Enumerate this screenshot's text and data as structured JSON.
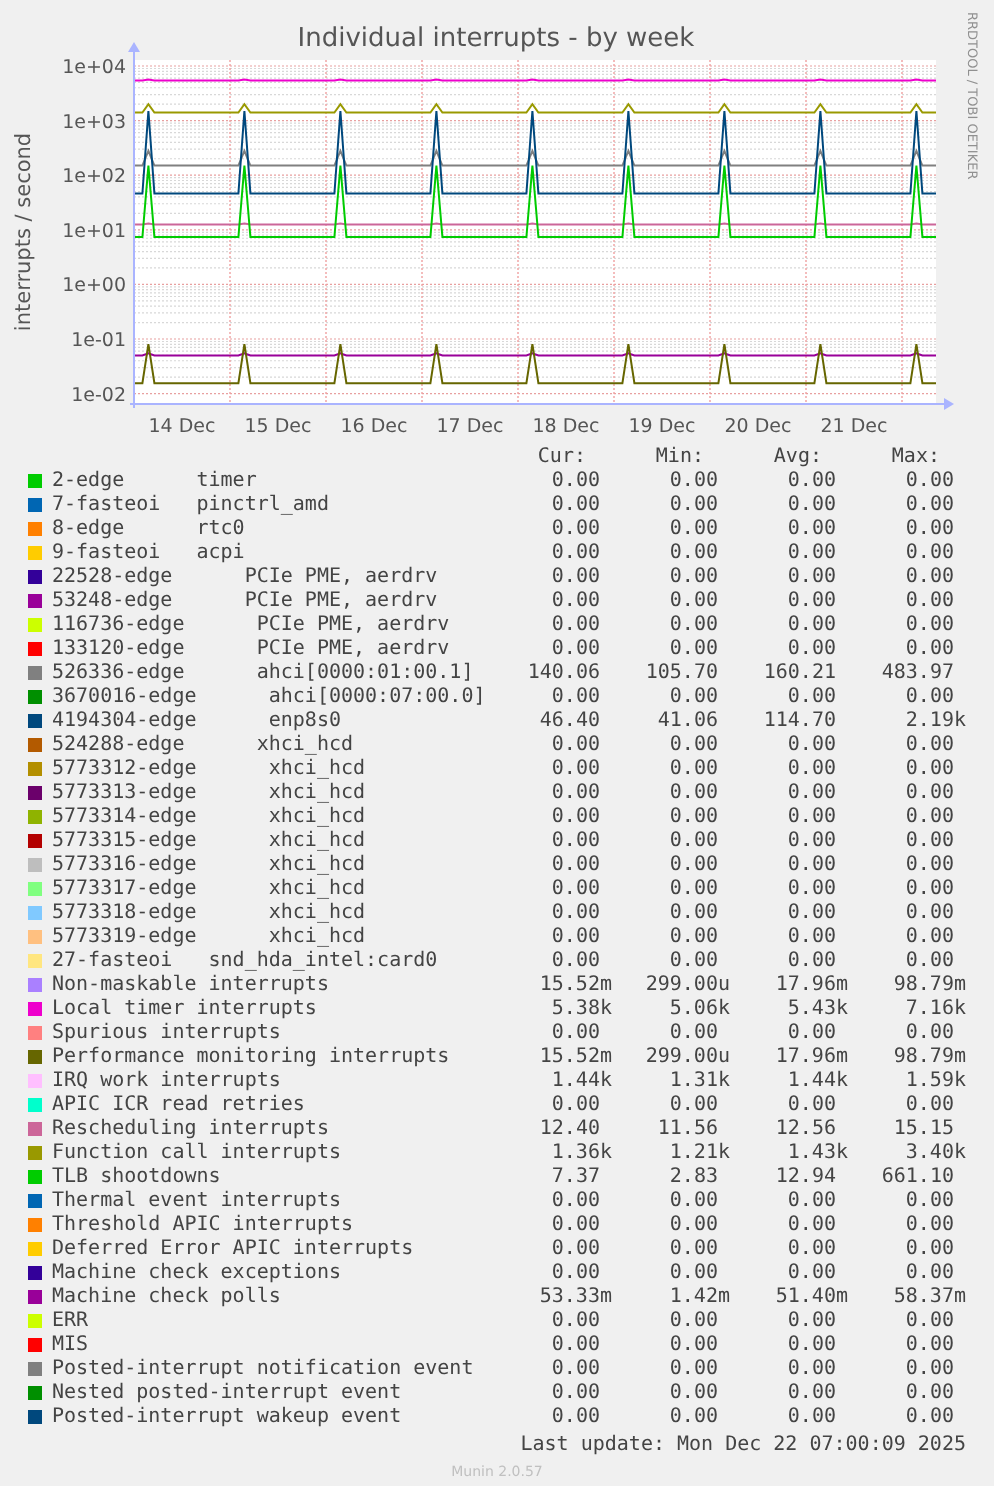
{
  "side_text": "RRDTOOL / TOBI OETIKER",
  "chart": {
    "title": "Individual interrupts - by week",
    "ylabel": "interrupts / second",
    "y_tick_labels": [
      "1e+04",
      "1e+03",
      "1e+02",
      "1e+01",
      "1e+00",
      "1e-01",
      "1e-02"
    ],
    "x_tick_labels": [
      "14 Dec",
      "15 Dec",
      "16 Dec",
      "17 Dec",
      "18 Dec",
      "19 Dec",
      "20 Dec",
      "21 Dec"
    ]
  },
  "legend": {
    "columns": [
      "Cur:",
      "Min:",
      "Avg:",
      "Max:"
    ],
    "rows": [
      {
        "name": "2-edge      timer",
        "color": "#00cc00",
        "cur": "0.00",
        "min": "0.00",
        "avg": "0.00",
        "max": "0.00"
      },
      {
        "name": "7-fasteoi   pinctrl_amd",
        "color": "#0066b3",
        "cur": "0.00",
        "min": "0.00",
        "avg": "0.00",
        "max": "0.00"
      },
      {
        "name": "8-edge      rtc0",
        "color": "#ff8000",
        "cur": "0.00",
        "min": "0.00",
        "avg": "0.00",
        "max": "0.00"
      },
      {
        "name": "9-fasteoi   acpi",
        "color": "#ffcc00",
        "cur": "0.00",
        "min": "0.00",
        "avg": "0.00",
        "max": "0.00"
      },
      {
        "name": "22528-edge      PCIe PME, aerdrv",
        "color": "#330099",
        "cur": "0.00",
        "min": "0.00",
        "avg": "0.00",
        "max": "0.00"
      },
      {
        "name": "53248-edge      PCIe PME, aerdrv",
        "color": "#990099",
        "cur": "0.00",
        "min": "0.00",
        "avg": "0.00",
        "max": "0.00"
      },
      {
        "name": "116736-edge      PCIe PME, aerdrv",
        "color": "#ccff00",
        "cur": "0.00",
        "min": "0.00",
        "avg": "0.00",
        "max": "0.00"
      },
      {
        "name": "133120-edge      PCIe PME, aerdrv",
        "color": "#ff0000",
        "cur": "0.00",
        "min": "0.00",
        "avg": "0.00",
        "max": "0.00"
      },
      {
        "name": "526336-edge      ahci[0000:01:00.1]",
        "color": "#808080",
        "cur": "140.06",
        "min": "105.70",
        "avg": "160.21",
        "max": "483.97"
      },
      {
        "name": "3670016-edge      ahci[0000:07:00.0]",
        "color": "#008f00",
        "cur": "0.00",
        "min": "0.00",
        "avg": "0.00",
        "max": "0.00"
      },
      {
        "name": "4194304-edge      enp8s0",
        "color": "#00487d",
        "cur": "46.40",
        "min": "41.06",
        "avg": "114.70",
        "max": "2.19k"
      },
      {
        "name": "524288-edge      xhci_hcd",
        "color": "#b35a00",
        "cur": "0.00",
        "min": "0.00",
        "avg": "0.00",
        "max": "0.00"
      },
      {
        "name": "5773312-edge      xhci_hcd",
        "color": "#b38f00",
        "cur": "0.00",
        "min": "0.00",
        "avg": "0.00",
        "max": "0.00"
      },
      {
        "name": "5773313-edge      xhci_hcd",
        "color": "#6b006b",
        "cur": "0.00",
        "min": "0.00",
        "avg": "0.00",
        "max": "0.00"
      },
      {
        "name": "5773314-edge      xhci_hcd",
        "color": "#8fb300",
        "cur": "0.00",
        "min": "0.00",
        "avg": "0.00",
        "max": "0.00"
      },
      {
        "name": "5773315-edge      xhci_hcd",
        "color": "#b30000",
        "cur": "0.00",
        "min": "0.00",
        "avg": "0.00",
        "max": "0.00"
      },
      {
        "name": "5773316-edge      xhci_hcd",
        "color": "#bebebe",
        "cur": "0.00",
        "min": "0.00",
        "avg": "0.00",
        "max": "0.00"
      },
      {
        "name": "5773317-edge      xhci_hcd",
        "color": "#80ff80",
        "cur": "0.00",
        "min": "0.00",
        "avg": "0.00",
        "max": "0.00"
      },
      {
        "name": "5773318-edge      xhci_hcd",
        "color": "#80c9ff",
        "cur": "0.00",
        "min": "0.00",
        "avg": "0.00",
        "max": "0.00"
      },
      {
        "name": "5773319-edge      xhci_hcd",
        "color": "#ffc080",
        "cur": "0.00",
        "min": "0.00",
        "avg": "0.00",
        "max": "0.00"
      },
      {
        "name": "27-fasteoi   snd_hda_intel:card0",
        "color": "#ffe680",
        "cur": "0.00",
        "min": "0.00",
        "avg": "0.00",
        "max": "0.00"
      },
      {
        "name": "Non-maskable interrupts",
        "color": "#aa80ff",
        "cur": "15.52m",
        "min": "299.00u",
        "avg": "17.96m",
        "max": "98.79m"
      },
      {
        "name": "Local timer interrupts",
        "color": "#ee00cc",
        "cur": "5.38k",
        "min": "5.06k",
        "avg": "5.43k",
        "max": "7.16k"
      },
      {
        "name": "Spurious interrupts",
        "color": "#ff8080",
        "cur": "0.00",
        "min": "0.00",
        "avg": "0.00",
        "max": "0.00"
      },
      {
        "name": "Performance monitoring interrupts",
        "color": "#666600",
        "cur": "15.52m",
        "min": "299.00u",
        "avg": "17.96m",
        "max": "98.79m"
      },
      {
        "name": "IRQ work interrupts",
        "color": "#ffbfff",
        "cur": "1.44k",
        "min": "1.31k",
        "avg": "1.44k",
        "max": "1.59k"
      },
      {
        "name": "APIC ICR read retries",
        "color": "#00ffcc",
        "cur": "0.00",
        "min": "0.00",
        "avg": "0.00",
        "max": "0.00"
      },
      {
        "name": "Rescheduling interrupts",
        "color": "#cc6699",
        "cur": "12.40",
        "min": "11.56",
        "avg": "12.56",
        "max": "15.15"
      },
      {
        "name": "Function call interrupts",
        "color": "#999900",
        "cur": "1.36k",
        "min": "1.21k",
        "avg": "1.43k",
        "max": "3.40k"
      },
      {
        "name": "TLB shootdowns",
        "color": "#00cc00",
        "cur": "7.37",
        "min": "2.83",
        "avg": "12.94",
        "max": "661.10"
      },
      {
        "name": "Thermal event interrupts",
        "color": "#0066b3",
        "cur": "0.00",
        "min": "0.00",
        "avg": "0.00",
        "max": "0.00"
      },
      {
        "name": "Threshold APIC interrupts",
        "color": "#ff8000",
        "cur": "0.00",
        "min": "0.00",
        "avg": "0.00",
        "max": "0.00"
      },
      {
        "name": "Deferred Error APIC interrupts",
        "color": "#ffcc00",
        "cur": "0.00",
        "min": "0.00",
        "avg": "0.00",
        "max": "0.00"
      },
      {
        "name": "Machine check exceptions",
        "color": "#330099",
        "cur": "0.00",
        "min": "0.00",
        "avg": "0.00",
        "max": "0.00"
      },
      {
        "name": "Machine check polls",
        "color": "#990099",
        "cur": "53.33m",
        "min": "1.42m",
        "avg": "51.40m",
        "max": "58.37m"
      },
      {
        "name": "ERR",
        "color": "#ccff00",
        "cur": "0.00",
        "min": "0.00",
        "avg": "0.00",
        "max": "0.00"
      },
      {
        "name": "MIS",
        "color": "#ff0000",
        "cur": "0.00",
        "min": "0.00",
        "avg": "0.00",
        "max": "0.00"
      },
      {
        "name": "Posted-interrupt notification event",
        "color": "#808080",
        "cur": "0.00",
        "min": "0.00",
        "avg": "0.00",
        "max": "0.00"
      },
      {
        "name": "Nested posted-interrupt event",
        "color": "#008f00",
        "cur": "0.00",
        "min": "0.00",
        "avg": "0.00",
        "max": "0.00"
      },
      {
        "name": "Posted-interrupt wakeup event",
        "color": "#00487d",
        "cur": "0.00",
        "min": "0.00",
        "avg": "0.00",
        "max": "0.00"
      }
    ]
  },
  "last_update": "Last update: Mon Dec 22 07:00:09 2025",
  "footer": "Munin 2.0.57"
}
